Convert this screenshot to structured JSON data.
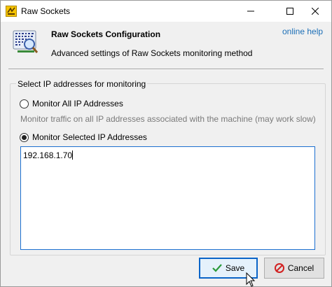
{
  "window": {
    "title": "Raw Sockets",
    "controls": {
      "minimize": "minimize",
      "maximize": "maximize",
      "close": "close"
    }
  },
  "header": {
    "title": "Raw Sockets Configuration",
    "subtitle": "Advanced settings of Raw Sockets monitoring method",
    "help_link": "online help",
    "icon": "network-scan-icon"
  },
  "group": {
    "legend": "Select IP addresses for monitoring",
    "options": [
      {
        "label": "Monitor All IP Addresses",
        "checked": false
      },
      {
        "label": "Monitor Selected IP Addresses",
        "checked": true
      }
    ],
    "hint": "Monitor traffic on all IP addresses associated with the machine (may work slow)",
    "ip_addresses": "192.168.1.70"
  },
  "buttons": {
    "save": "Save",
    "cancel": "Cancel"
  },
  "colors": {
    "link": "#1c6fb7",
    "focus_border": "#0a64c8",
    "cancel_icon": "#d22020",
    "save_icon": "#2a9a3a"
  }
}
